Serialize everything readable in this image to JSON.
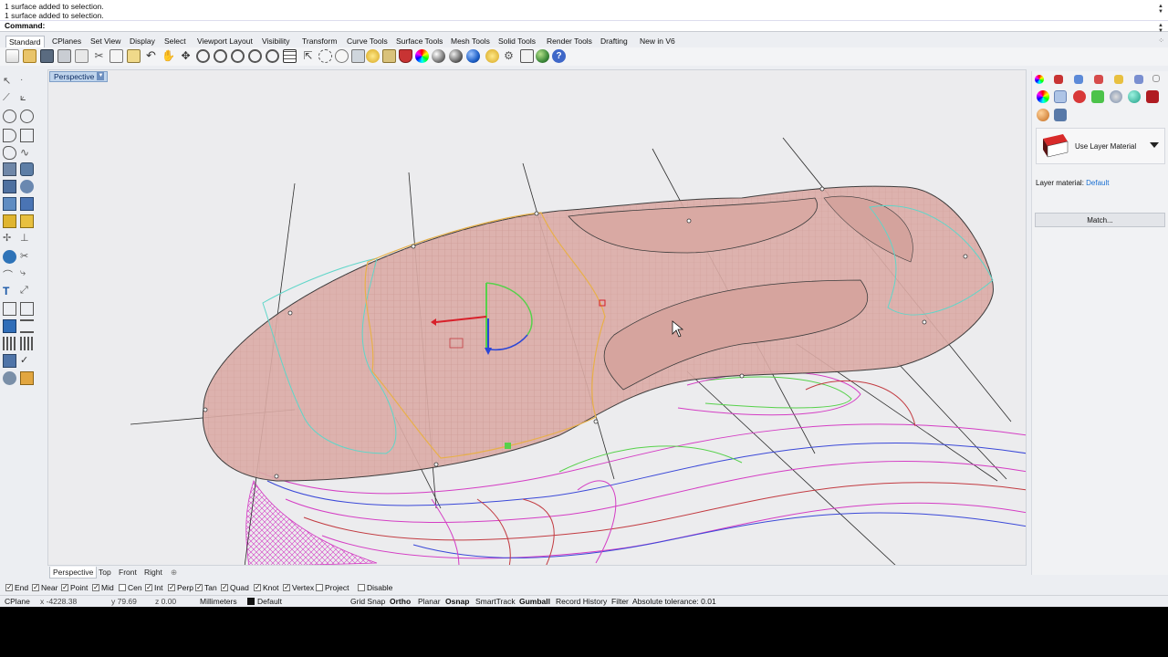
{
  "command_history": [
    "1 surface added to selection.",
    "1 surface added to selection."
  ],
  "command_label": "Command:",
  "command_value": "",
  "tabs": [
    "Standard",
    "CPlanes",
    "Set View",
    "Display",
    "Select",
    "Viewport Layout",
    "Visibility",
    "Transform",
    "Curve Tools",
    "Surface Tools",
    "Mesh Tools",
    "Solid Tools",
    "Render Tools",
    "Drafting",
    "New in V6"
  ],
  "active_tab": "Standard",
  "viewport": {
    "label": "Perspective",
    "caret": "▼"
  },
  "viewport_tabs": [
    "Perspective",
    "Top",
    "Front",
    "Right",
    "⊕"
  ],
  "material": {
    "label": "Use Layer Material",
    "layer_material_label": "Layer material:",
    "layer_material_value": "Default",
    "match_button": "Match..."
  },
  "osnaps": [
    {
      "label": "End",
      "checked": true
    },
    {
      "label": "Near",
      "checked": true
    },
    {
      "label": "Point",
      "checked": true
    },
    {
      "label": "Mid",
      "checked": true
    },
    {
      "label": "Cen",
      "checked": false
    },
    {
      "label": "Int",
      "checked": true
    },
    {
      "label": "Perp",
      "checked": true
    },
    {
      "label": "Tan",
      "checked": true
    },
    {
      "label": "Quad",
      "checked": true
    },
    {
      "label": "Knot",
      "checked": true
    },
    {
      "label": "Vertex",
      "checked": true
    },
    {
      "label": "Project",
      "checked": false
    },
    {
      "label": "Disable",
      "checked": false
    }
  ],
  "status": {
    "cplane": "CPlane",
    "x": "x -4228.38",
    "y": "y 79.69",
    "z": "z 0.00",
    "units": "Millimeters",
    "layer": "Default",
    "grid_snap": "Grid Snap",
    "ortho": "Ortho",
    "planar": "Planar",
    "osnap": "Osnap",
    "smarttrack": "SmartTrack",
    "gumball": "Gumball",
    "record_history": "Record History",
    "filter": "Filter",
    "tolerance": "Absolute tolerance: 0.01"
  },
  "colors": {
    "surface_fill": "#dcaca6",
    "surface_edge": "#3b3b3b",
    "selection_outline": "#e8b04a",
    "curve_cyan": "#5fd6c9",
    "curve_magenta": "#d43dc4",
    "curve_blue": "#3a48d8",
    "curve_red": "#c23a40",
    "curve_green": "#56d14a"
  },
  "icons": {
    "toolbar": [
      "new-icon",
      "open-icon",
      "save-icon",
      "print-icon",
      "import-icon",
      "cut-icon",
      "copy-icon",
      "paste-icon",
      "undo-icon",
      "pan-icon",
      "rotate-view-icon",
      "zoom-dynamic-icon",
      "zoom-window-icon",
      "zoom-extents-icon",
      "zoom-selected-icon",
      "grid-icon",
      "select-icon",
      "points-on-icon",
      "light-icon",
      "lock-icon",
      "object-props-icon",
      "color-wheel-icon",
      "sphere-shade-icon",
      "sphere-render-icon",
      "render-icon",
      "bulb-icon",
      "settings-icon",
      "gumball-icon",
      "globe-icon",
      "help-icon"
    ],
    "right_panel": [
      "color-wheel-icon",
      "shield-icon",
      "material-icon",
      "paint-icon",
      "folder-icon",
      "display-icon",
      "color-wheel-icon",
      "brush-icon",
      "render-icon",
      "texture-icon",
      "mapping-icon",
      "environment-icon",
      "ground-plane-icon",
      "sun-icon",
      "camera-icon"
    ]
  }
}
